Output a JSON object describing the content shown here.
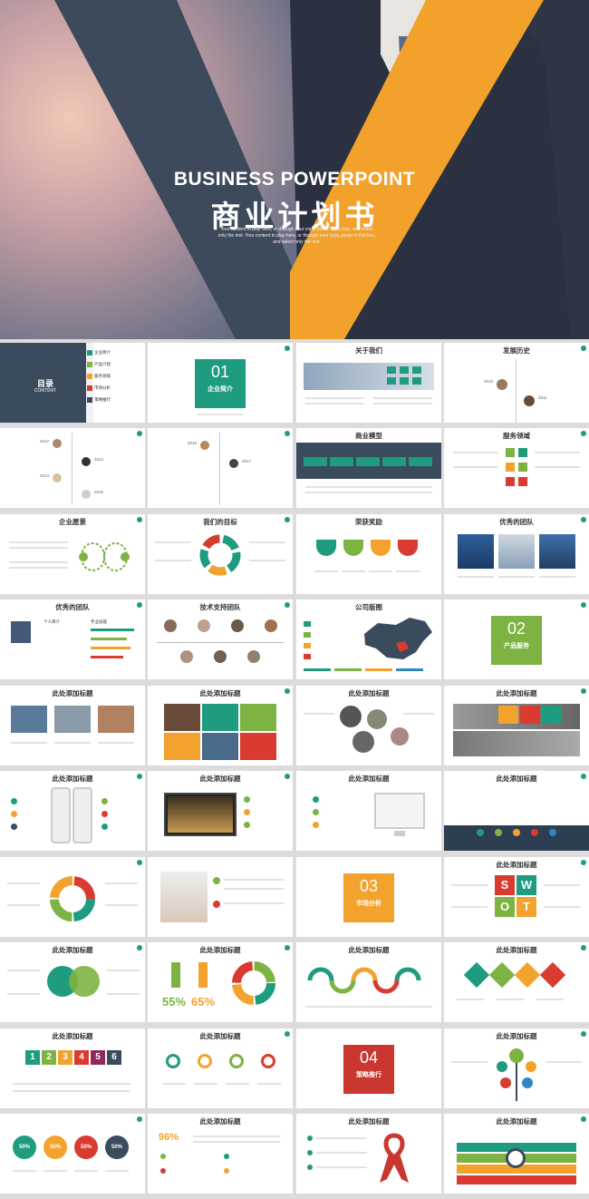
{
  "hero": {
    "title_en": "BUSINESS POWERPOINT",
    "title_cn": "商业计划书",
    "subtitle": "Your content to play here, or through your copy, paste in this box, and select only the text. Your content to play here, or through your copy, paste in this box, and select only the text."
  },
  "toc": {
    "title": "目录",
    "sub": "CONTENT",
    "items": [
      "企业简介",
      "产品介绍",
      "服务领域",
      "市场分析",
      "策略推行"
    ]
  },
  "slides": {
    "s2_num": "01",
    "s2_label": "企业简介",
    "s3": "关于我们",
    "s4": "发展历史",
    "s4_years": [
      "2010",
      "2011"
    ],
    "s5_years": [
      "2012",
      "2013",
      "2014",
      "2015"
    ],
    "s6_years": [
      "2016",
      "2017"
    ],
    "s7": "商业模型",
    "s8": "服务领域",
    "s9": "企业愿景",
    "s10": "我们的目标",
    "s11": "荣获奖励",
    "s12": "优秀的团队",
    "s13": "优秀的团队",
    "s13_a": "个人简介",
    "s13_b": "专业技能",
    "s14": "技术支持团队",
    "s15": "公司版图",
    "s16_num": "02",
    "s16_label": "产品服务",
    "h": "此处添加标题",
    "s35_num": "03",
    "s35_label": "市场分析",
    "s36": [
      "S",
      "W",
      "O",
      "T"
    ],
    "s38_pct": [
      "55%",
      "65%"
    ],
    "s45_nums": [
      "1",
      "2",
      "3",
      "4",
      "5",
      "6"
    ],
    "s47_num": "04",
    "s47_label": "策略推行",
    "s49_pct": [
      "50%",
      "50%",
      "50%",
      "50%"
    ],
    "s50_pct": "96%"
  },
  "colors": {
    "navy": "#3b4b5e",
    "orange": "#f3a32d",
    "teal": "#1f9b7f",
    "green": "#7cb342",
    "red": "#d93b30",
    "blue": "#2e86c1"
  }
}
